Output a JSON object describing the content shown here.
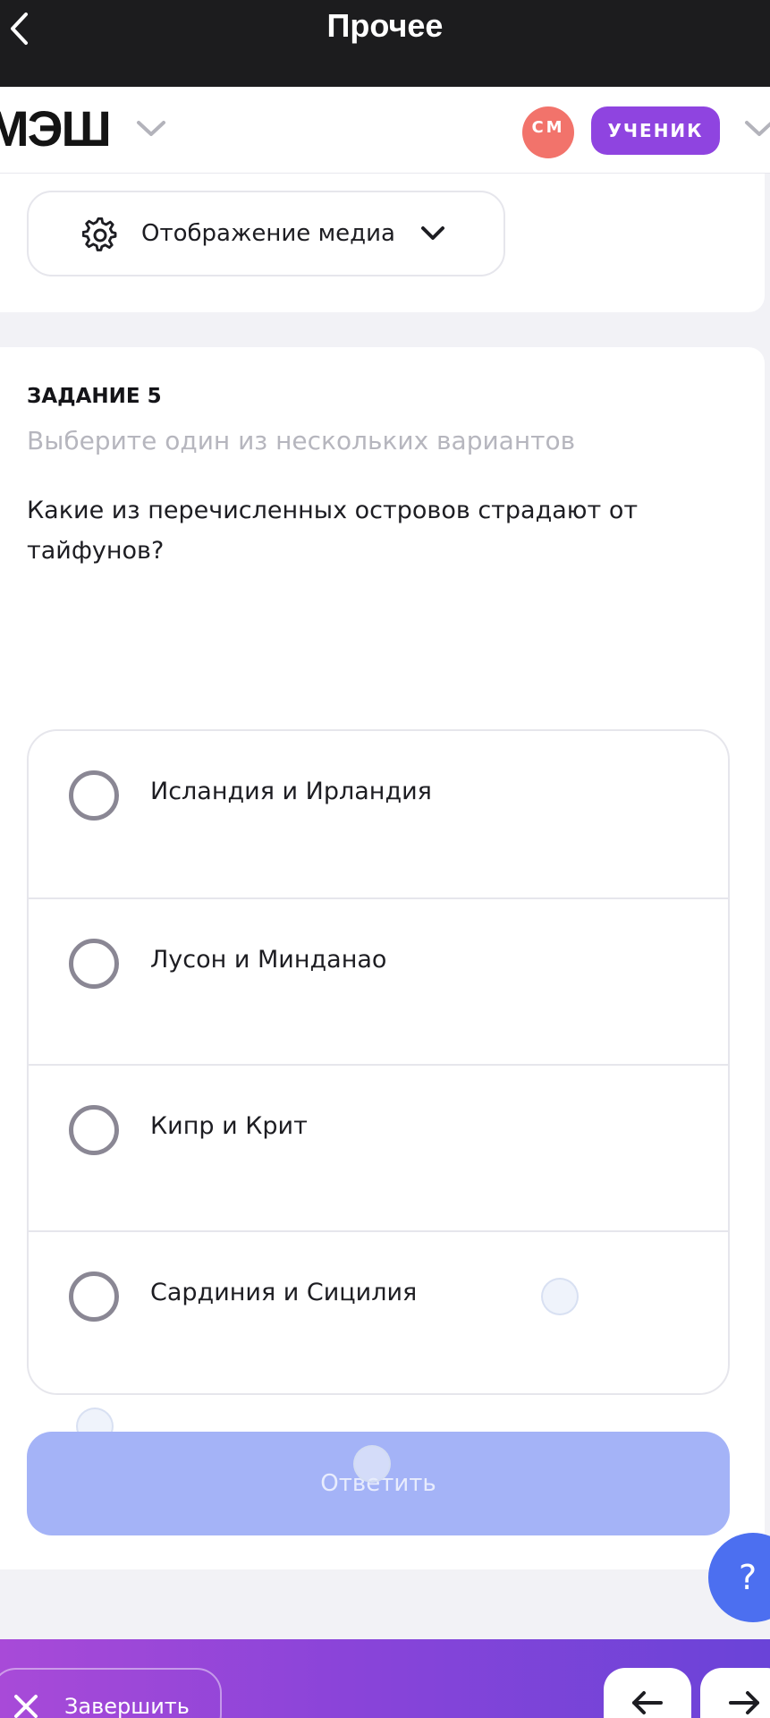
{
  "topbar": {
    "title": "Прочее"
  },
  "header": {
    "logo": "МЭШ",
    "avatar_initials": "СМ",
    "role_badge": "УЧЕНИК"
  },
  "media": {
    "label": "Отображение медиа"
  },
  "task": {
    "number": "ЗАДАНИЕ 5",
    "hint": "Выберите один из нескольких вариантов",
    "question": "Какие из перечисленных островов страдают от тайфунов?",
    "options": [
      {
        "label": "Исландия и Ирландия"
      },
      {
        "label": "Лусон и Минданао"
      },
      {
        "label": "Кипр и Крит"
      },
      {
        "label": "Сардиния и Сицилия"
      }
    ],
    "answer_label": "Ответить"
  },
  "help": {
    "label": "?"
  },
  "bottombar": {
    "finish_label": "Завершить"
  },
  "colors": {
    "accent": "#8f44e0",
    "avatar": "#f2736b",
    "answer_button": "#a4b3f7",
    "help_button": "#4c6ff0"
  }
}
